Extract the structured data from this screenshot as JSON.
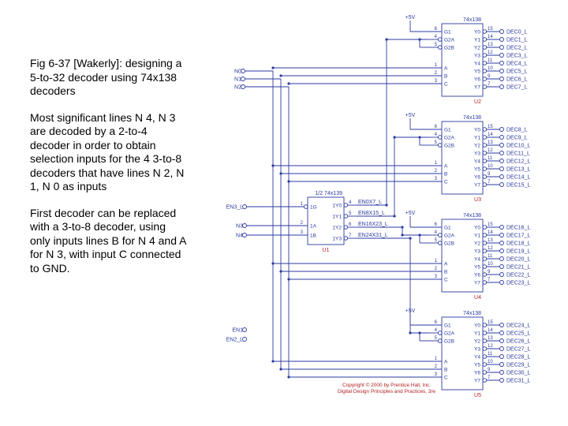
{
  "text": {
    "p1": "Fig 6-37 [Wakerly]: designing a 5-to-32 decoder using 74x138 decoders",
    "p2": "Most significant lines N 4, N 3 are decoded by a 2-to-4 decoder in order to obtain selection inputs for the 4 3-to-8 decoders that have lines N 2, N 1, N 0 as inputs",
    "p3": "First decoder can be replaced with a 3-to-8 decoder, using only inputs lines B for N 4 and A for N 3, with input C connected to GND."
  },
  "copyright": {
    "l1": "Copyright © 2000 by Prentice Hall, Inc.",
    "l2": "Digital Design Principles and Practices, 3/e"
  },
  "u1": {
    "part": "1/2 74x139",
    "ref": "U1",
    "en_pin": "1",
    "en_lbl": "1G",
    "a_pin": "2",
    "a_lbl": "1A",
    "b_pin": "3",
    "b_lbl": "1B",
    "y0_pin": "4",
    "y0_lbl": "1Y0",
    "y0_net": "EN0X7_L",
    "y1_pin": "5",
    "y1_lbl": "1Y1",
    "y1_net": "EN8X15_L",
    "y2_pin": "6",
    "y2_lbl": "1Y2",
    "y2_net": "EN16X23_L",
    "y3_pin": "7",
    "y3_lbl": "1Y3",
    "y3_net": "EN24X31_L",
    "in_en": "EN3_L",
    "in_a": "N3",
    "in_b": "N4"
  },
  "addr": {
    "n0": "N0",
    "n1": "N1",
    "n2": "N2"
  },
  "extra": {
    "en1": "EN1",
    "en2l": "EN2_L"
  },
  "u138": {
    "part": "74x138",
    "g1_pin": "6",
    "g1_lbl": "G1",
    "g2a_pin": "4",
    "g2a_lbl": "G2A",
    "g2b_pin": "5",
    "g2b_lbl": "G2B",
    "a_pin": "1",
    "a_lbl": "A",
    "b_pin": "2",
    "b_lbl": "B",
    "c_pin": "3",
    "c_lbl": "C",
    "y_pins": [
      "15",
      "14",
      "13",
      "12",
      "11",
      "10",
      "9",
      "7"
    ],
    "y_lbls": [
      "Y0",
      "Y1",
      "Y2",
      "Y3",
      "Y4",
      "Y5",
      "Y6",
      "Y7"
    ]
  },
  "outs": {
    "u2": [
      "DEC0_L",
      "DEC1_L",
      "DEC2_L",
      "DEC3_L",
      "DEC4_L",
      "DEC5_L",
      "DEC6_L",
      "DEC7_L"
    ],
    "u3": [
      "DEC8_L",
      "DEC9_L",
      "DEC10_L",
      "DEC11_L",
      "DEC12_L",
      "DEC13_L",
      "DEC14_L",
      "DEC15_L"
    ],
    "u4": [
      "DEC16_L",
      "DEC17_L",
      "DEC18_L",
      "DEC19_L",
      "DEC20_L",
      "DEC21_L",
      "DEC22_L",
      "DEC23_L"
    ],
    "u5": [
      "DEC24_L",
      "DEC25_L",
      "DEC26_L",
      "DEC27_L",
      "DEC28_L",
      "DEC29_L",
      "DEC30_L",
      "DEC31_L"
    ]
  },
  "refs": {
    "u2": "U2",
    "u3": "U3",
    "u4": "U4",
    "u5": "U5"
  },
  "plus5": "+5V"
}
